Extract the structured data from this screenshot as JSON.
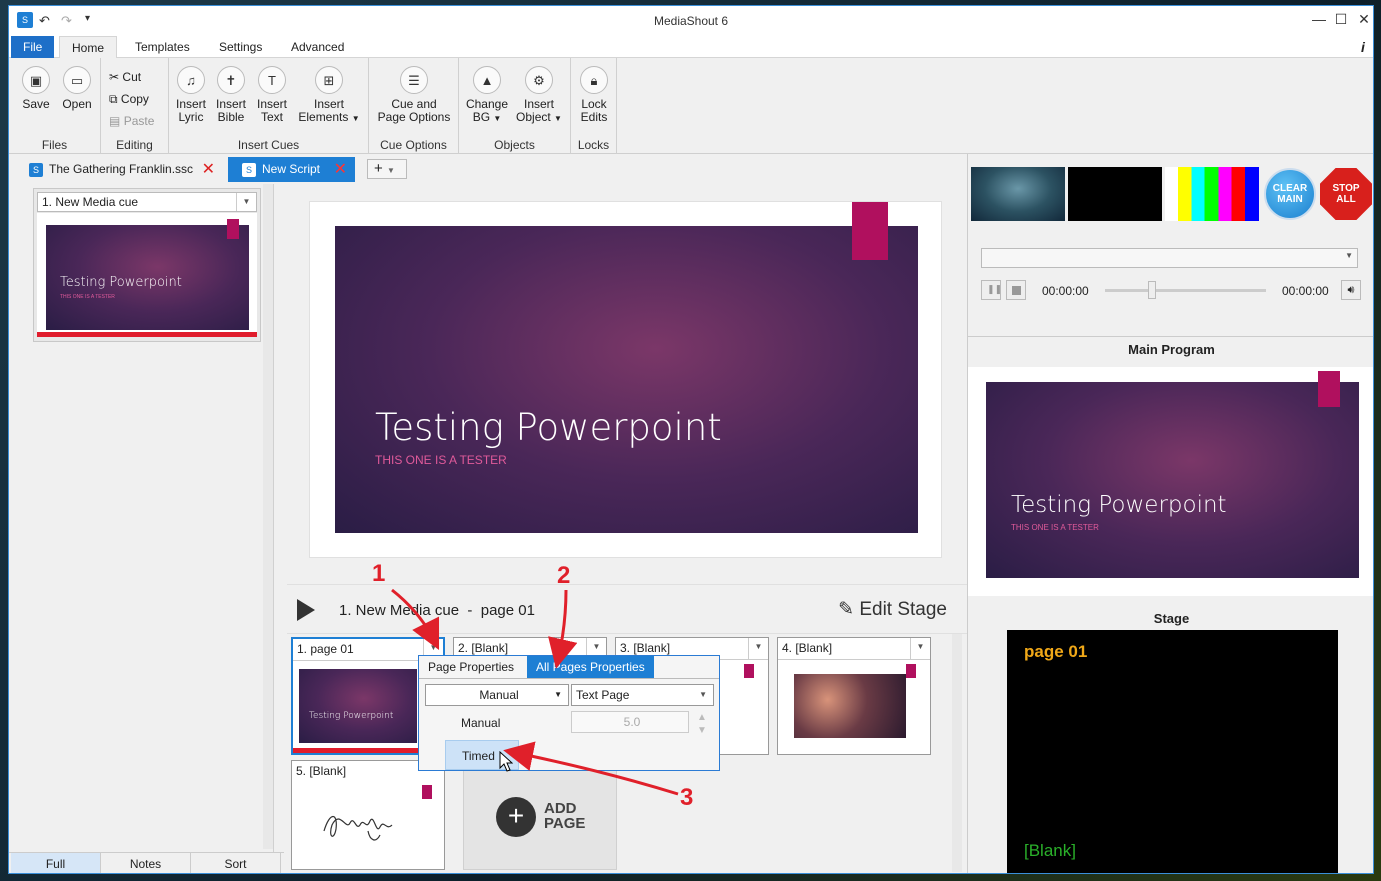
{
  "window": {
    "title": "MediaShout 6"
  },
  "menu": {
    "file": "File",
    "tabs": [
      "Home",
      "Templates",
      "Settings",
      "Advanced"
    ],
    "info": "i"
  },
  "ribbon": {
    "files": {
      "label": "Files",
      "save": "Save",
      "open": "Open"
    },
    "editing": {
      "label": "Editing",
      "cut": "Cut",
      "copy": "Copy",
      "paste": "Paste"
    },
    "insert_cues": {
      "label": "Insert Cues",
      "lyric": [
        "Insert",
        "Lyric"
      ],
      "bible": [
        "Insert",
        "Bible"
      ],
      "text": [
        "Insert",
        "Text"
      ],
      "elements": [
        "Insert",
        "Elements"
      ]
    },
    "cue_options": {
      "label": "Cue Options",
      "btn": [
        "Cue and",
        "Page Options"
      ]
    },
    "objects": {
      "label": "Objects",
      "change_bg": [
        "Change",
        "BG"
      ],
      "insert_object": [
        "Insert",
        "Object"
      ]
    },
    "locks": {
      "label": "Locks",
      "lock": [
        "Lock",
        "Edits"
      ]
    }
  },
  "doc_tabs": [
    {
      "label": "The Gathering Franklin.ssc"
    },
    {
      "label": "New Script"
    }
  ],
  "sidebar": {
    "cue": {
      "title": "1. New Media cue"
    },
    "tabs": [
      "Full",
      "Notes",
      "Sort"
    ]
  },
  "slide": {
    "title": "Testing Powerpoint",
    "subtitle": "THIS ONE IS A TESTER"
  },
  "player": {
    "title": "1. New Media cue  -  page 01",
    "edit_stage": "Edit Stage"
  },
  "pages": [
    {
      "label": "1. page 01"
    },
    {
      "label": "2. [Blank]"
    },
    {
      "label": "3. [Blank]"
    },
    {
      "label": "4. [Blank]"
    },
    {
      "label": "5. [Blank]"
    }
  ],
  "add_page": {
    "line1": "ADD",
    "line2": "PAGE"
  },
  "popup": {
    "tabs": [
      "Page Properties",
      "All Pages Properties"
    ],
    "mode_selected": "Manual",
    "type_selected": "Text Page",
    "duration": "5.0",
    "options": [
      "Manual",
      "Timed"
    ]
  },
  "right": {
    "clear_main": [
      "CLEAR",
      "MAIN"
    ],
    "stop_all": [
      "STOP",
      "ALL"
    ],
    "time_start": "00:00:00",
    "time_end": "00:00:00",
    "main_program": "Main Program",
    "stage": "Stage",
    "stage_top": "page 01",
    "stage_bottom": "[Blank]"
  },
  "annotations": [
    "1",
    "2",
    "3"
  ],
  "colors": {
    "accent": "#1e7fd4",
    "annotation": "#e0202a",
    "tag": "#b0105e"
  }
}
